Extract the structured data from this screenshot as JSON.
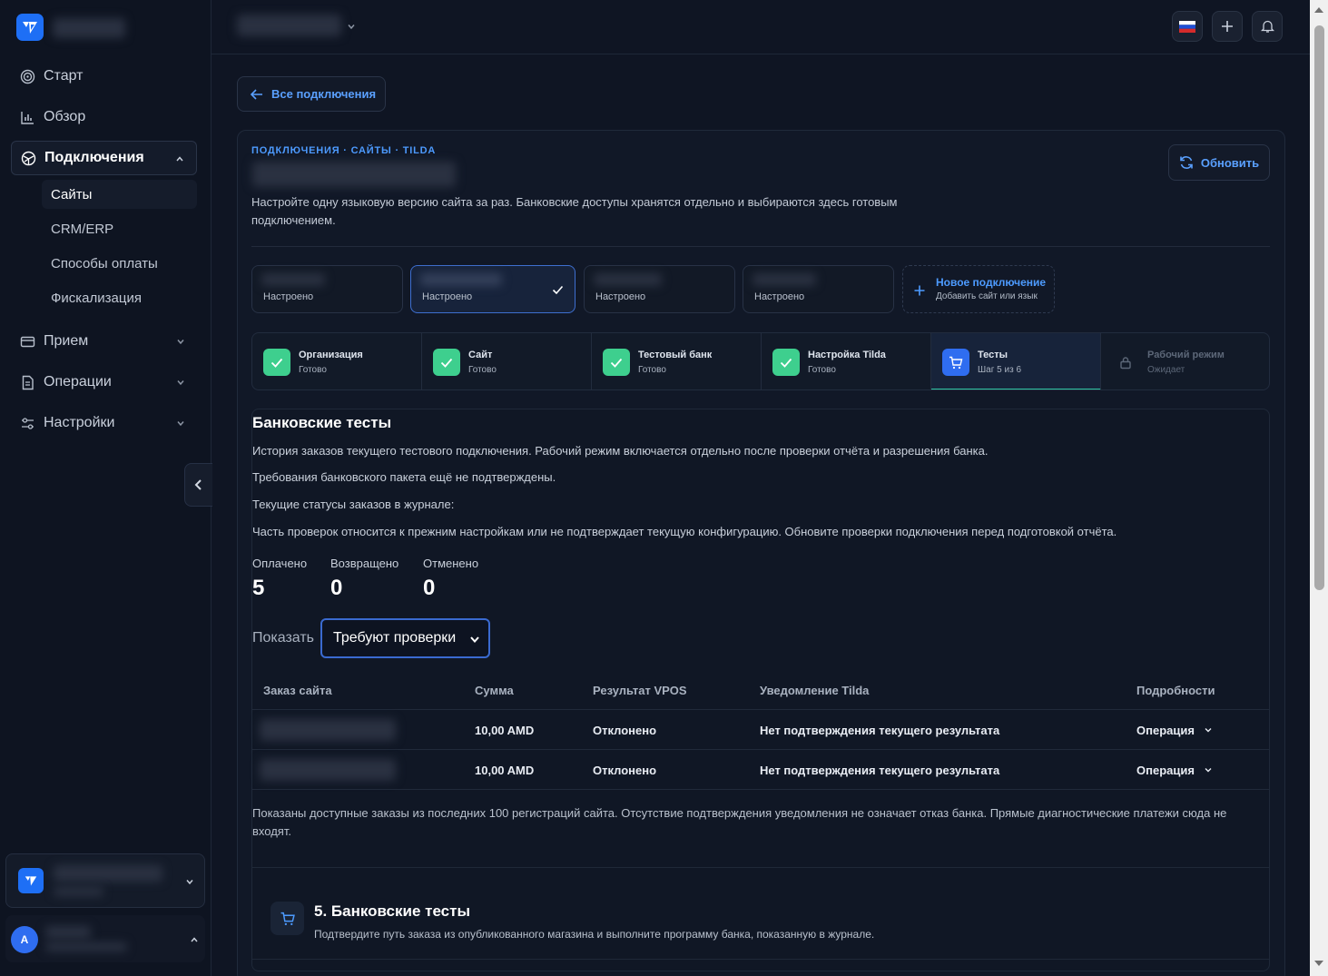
{
  "sidebar": {
    "nav": [
      {
        "label": "Старт",
        "icon": "target-icon"
      },
      {
        "label": "Обзор",
        "icon": "chart-icon"
      },
      {
        "label": "Подключения",
        "icon": "network-icon"
      }
    ],
    "sub_items": [
      "Сайты",
      "CRM/ERP",
      "Способы оплаты",
      "Фискализация"
    ],
    "nav2": [
      {
        "label": "Прием",
        "icon": "card-icon"
      },
      {
        "label": "Операции",
        "icon": "document-icon"
      },
      {
        "label": "Настройки",
        "icon": "sliders-icon"
      }
    ],
    "user_initial": "A"
  },
  "main": {
    "back_label": "Все подключения",
    "breadcrumb": "ПОДКЛЮЧЕНИЯ · САЙТЫ · TILDA",
    "description": "Настройте одну языковую версию сайта за раз. Банковские доступы хранятся отдельно и выбираются здесь готовым подключением.",
    "refresh_label": "Обновить",
    "connections": [
      {
        "status": "Настроено",
        "selected": false
      },
      {
        "status": "Настроено",
        "selected": true
      },
      {
        "status": "Настроено",
        "selected": false
      },
      {
        "status": "Настроено",
        "selected": false
      }
    ],
    "new_connection": {
      "title": "Новое подключение",
      "subtitle": "Добавить сайт или язык"
    },
    "steps": [
      {
        "title": "Организация",
        "sub": "Готово",
        "state": "done"
      },
      {
        "title": "Сайт",
        "sub": "Готово",
        "state": "done"
      },
      {
        "title": "Тестовый банк",
        "sub": "Готово",
        "state": "done"
      },
      {
        "title": "Настройка Tilda",
        "sub": "Готово",
        "state": "done"
      },
      {
        "title": "Тесты",
        "sub": "Шаг 5 из 6",
        "state": "current"
      },
      {
        "title": "Рабочий режим",
        "sub": "Ожидает",
        "state": "pending"
      }
    ],
    "section_title": "Банковские тесты",
    "paragraphs": [
      "История заказов текущего тестового подключения. Рабочий режим включается отдельно после проверки отчёта и разрешения банка.",
      "Требования банковского пакета ещё не подтверждены.",
      "Текущие статусы заказов в журнале:",
      "Часть проверок относится к прежним настройкам или не подтверждает текущую конфигурацию. Обновите проверки подключения перед подготовкой отчёта."
    ],
    "stats": [
      {
        "label": "Оплачено",
        "value": "5"
      },
      {
        "label": "Возвращено",
        "value": "0"
      },
      {
        "label": "Отменено",
        "value": "0"
      }
    ],
    "filter": {
      "label": "Показать",
      "selected": "Требуют проверки"
    },
    "table": {
      "headers": [
        "Заказ сайта",
        "Сумма",
        "Результат VPOS",
        "Уведомление Tilda",
        "Подробности"
      ],
      "rows": [
        {
          "amount": "10,00 AMD",
          "vpos": "Отклонено",
          "tilda": "Нет подтверждения текущего результата",
          "details": "Операция"
        },
        {
          "amount": "10,00 AMD",
          "vpos": "Отклонено",
          "tilda": "Нет подтверждения текущего результата",
          "details": "Операция"
        }
      ]
    },
    "footnote": "Показаны доступные заказы из последних 100 регистраций сайта. Отсутствие подтверждения уведомления не означает отказ банка. Прямые диагностические платежи сюда не входят.",
    "next_section": {
      "title": "5. Банковские тесты",
      "subtitle": "Подтвердите путь заказа из опубликованного магазина и выполните программу банка, показанную в журнале."
    }
  },
  "colors": {
    "accent": "#4d9bff",
    "success": "#3ecf8e",
    "brand": "#1e6ff5"
  }
}
